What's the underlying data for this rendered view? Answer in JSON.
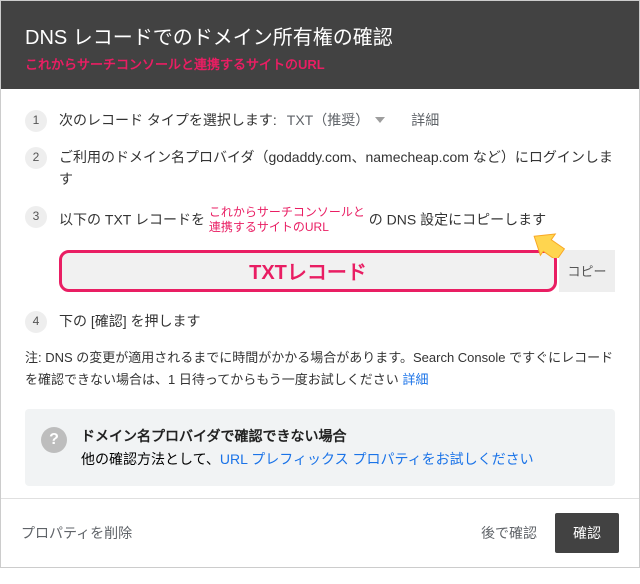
{
  "header": {
    "title": "DNS レコードでのドメイン所有権の確認",
    "annotation": "これからサーチコンソールと連携するサイトのURL"
  },
  "steps": {
    "s1": {
      "num": "1",
      "label": "次のレコード タイプを選択します:",
      "type_value": "TXT（推奨）",
      "detail": "詳細"
    },
    "s2": {
      "num": "2",
      "text": "ご利用のドメイン名プロバイダ（godaddy.com、namecheap.com など）にログインします"
    },
    "s3": {
      "num": "3",
      "before": "以下の TXT レコードを",
      "anno_line1": "これからサーチコンソールと",
      "anno_line2": "連携するサイトのURL",
      "after": "の DNS 設定にコピーします"
    },
    "txt_label": "TXTレコード",
    "copy": "コピー",
    "s4": {
      "num": "4",
      "text": "下の [確認] を押します"
    }
  },
  "note": {
    "text": "注: DNS の変更が適用されるまでに時間がかかる場合があります。Search Console ですぐにレコードを確認できない場合は、1 日待ってからもう一度お試しください",
    "link": "詳細"
  },
  "altbox": {
    "title": "ドメイン名プロバイダで確認できない場合",
    "prefix": "他の確認方法として、",
    "link": "URL プレフィックス プロパティをお試しください"
  },
  "footer": {
    "delete": "プロパティを削除",
    "later": "後で確認",
    "confirm": "確認"
  }
}
